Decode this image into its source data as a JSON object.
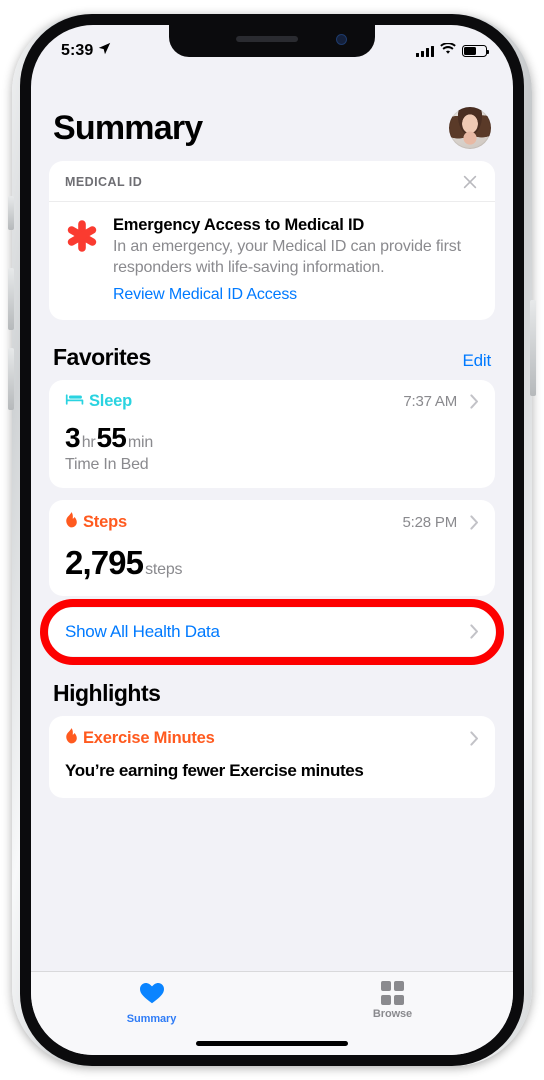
{
  "status_bar": {
    "time": "5:39",
    "location_icon": "location-arrow-icon",
    "signal_icon": "cellular-bars-icon",
    "wifi_icon": "wifi-icon",
    "battery_icon": "battery-icon",
    "battery_level_percent": 55
  },
  "header": {
    "title": "Summary",
    "avatar": "user-avatar"
  },
  "medical_id_card": {
    "section_label": "MEDICAL ID",
    "close_icon": "close-icon",
    "asterisk_icon": "medical-asterisk-icon",
    "title": "Emergency Access to Medical ID",
    "description": "In an emergency, your Medical ID can provide first responders with life-saving information.",
    "link_label": "Review Medical ID Access"
  },
  "favorites": {
    "title": "Favorites",
    "edit_label": "Edit",
    "items": [
      {
        "icon": "bed-icon",
        "name": "Sleep",
        "color": "#2ad3e0",
        "time": "7:37 AM",
        "value_parts": [
          {
            "num": "3",
            "unit": "hr"
          },
          {
            "num": "55",
            "unit": "min"
          }
        ],
        "subtitle": "Time In Bed"
      },
      {
        "icon": "flame-icon",
        "name": "Steps",
        "color": "#ff5a1f",
        "time": "5:28 PM",
        "value_parts": [
          {
            "num": "2,795",
            "unit": "steps"
          }
        ],
        "subtitle": ""
      }
    ],
    "show_all_label": "Show All Health Data",
    "show_all_highlight_color": "#fd0000"
  },
  "highlights": {
    "title": "Highlights",
    "card": {
      "icon": "flame-icon",
      "name": "Exercise Minutes",
      "color": "#ff5a1f",
      "text": "You’re earning fewer Exercise minutes"
    }
  },
  "tab_bar": {
    "tabs": [
      {
        "label": "Summary",
        "icon": "heart-icon",
        "active": true
      },
      {
        "label": "Browse",
        "icon": "grid-icon",
        "active": false
      }
    ]
  }
}
